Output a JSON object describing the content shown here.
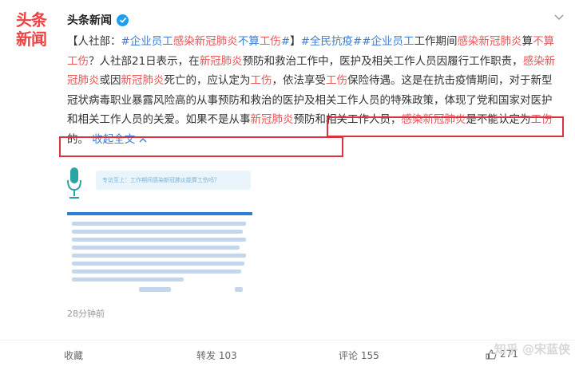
{
  "account": {
    "logo_line1": "头条",
    "logo_line2": "新闻",
    "name": "头条新闻"
  },
  "post": {
    "p1": "【人社部：",
    "tag1": "#企业员工",
    "hl1": "感染新冠肺炎",
    "p2": "不算",
    "hl2": "工伤",
    "tag1_end": "#",
    "p3": "】",
    "tag2": "#全民抗疫#",
    "tag3": "#企业员工",
    "p4": "工作期间",
    "hl3": "感染新冠肺炎",
    "p5": "算",
    "hl4": "不算工伤",
    "p6": "？人社部21日表示，在",
    "hl5": "新冠肺炎",
    "p7": "预防和救治工作中，医护及相关工作人员因履行工作职责，",
    "hl6": "感染新冠肺炎",
    "p8": "或因",
    "hl7": "新冠肺炎",
    "p9": "死亡的，应认定为",
    "hl8": "工伤",
    "p10": "，依法享受",
    "hl9": "工伤",
    "p11": "保险待遇。这是在抗击疫情期间，对于新型冠状病毒职业暴露风险高的从事预防和救治的医护及相关工作人员的特殊政策，体现了党和国家对医护和相关工作人员的关爱。",
    "p12": "如果不是从事",
    "hl10": "新冠肺炎",
    "p13": "预防和相关工作人员，",
    "hl11": "感染新冠肺炎",
    "p14": "是不能认定为",
    "hl12": "工伤",
    "p15": "的。",
    "collapse": "收起全文",
    "collapse_icon": "chevron-up-icon"
  },
  "image": {
    "banner": "专访至上：工作期间感染新冠肺炎能算工伤吗？"
  },
  "timestamp": "28分钟前",
  "actions": {
    "favorite": "收藏",
    "repost": "转发 103",
    "comment": "评论 155",
    "like": "271"
  },
  "watermark": "知乎 @宋蓝侠",
  "colors": {
    "highlight": "#e8575a",
    "link": "#3d7dd6",
    "box": "#d9333f",
    "brand": "#f04142"
  }
}
